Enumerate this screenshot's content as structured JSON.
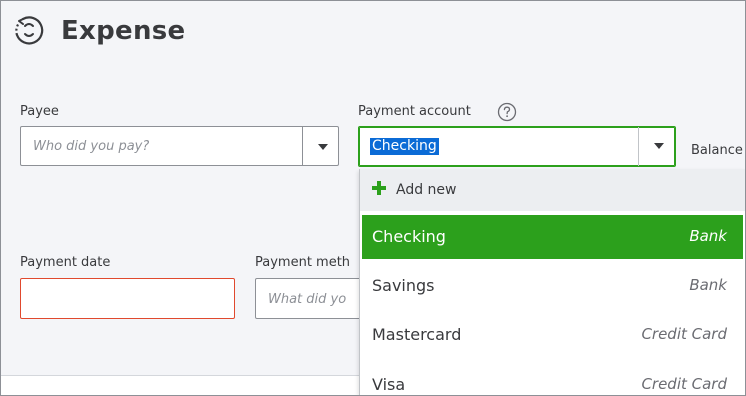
{
  "header": {
    "title": "Expense",
    "icon": "expense-clock-icon"
  },
  "payee": {
    "label": "Payee",
    "placeholder": "Who did you pay?",
    "icon": "chevron-down-icon"
  },
  "payment_account": {
    "label": "Payment account",
    "help_icon": "help-circle-icon",
    "value": "Checking",
    "icon": "chevron-down-icon",
    "highlight_color": "#0b6bd6",
    "focus_color": "#2ca01c"
  },
  "balance": {
    "label": "Balance"
  },
  "payment_date": {
    "label": "Payment date",
    "error_color": "#e0492e"
  },
  "payment_method": {
    "label": "Payment meth",
    "placeholder": "What did yo"
  },
  "dropdown": {
    "add_new": {
      "label": "Add new",
      "icon": "plus-icon",
      "color": "#2ca01c"
    },
    "items": [
      {
        "name": "Checking",
        "type": "Bank",
        "selected": true
      },
      {
        "name": "Savings",
        "type": "Bank",
        "selected": false
      },
      {
        "name": "Mastercard",
        "type": "Credit Card",
        "selected": false
      },
      {
        "name": "Visa",
        "type": "Credit Card",
        "selected": false
      }
    ]
  }
}
